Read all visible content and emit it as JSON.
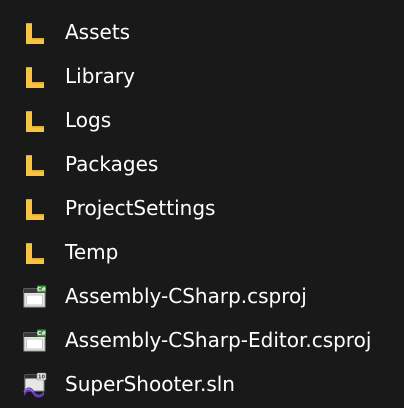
{
  "items": [
    {
      "label": "Assets",
      "type": "folder",
      "icon": "folder-icon"
    },
    {
      "label": "Library",
      "type": "folder",
      "icon": "folder-icon"
    },
    {
      "label": "Logs",
      "type": "folder",
      "icon": "folder-icon"
    },
    {
      "label": "Packages",
      "type": "folder",
      "icon": "folder-icon"
    },
    {
      "label": "ProjectSettings",
      "type": "folder",
      "icon": "folder-icon"
    },
    {
      "label": "Temp",
      "type": "folder",
      "icon": "folder-icon"
    },
    {
      "label": "Assembly-CSharp.csproj",
      "type": "csproj",
      "icon": "csproj-file-icon"
    },
    {
      "label": "Assembly-CSharp-Editor.csproj",
      "type": "csproj",
      "icon": "csproj-file-icon"
    },
    {
      "label": "SuperShooter.sln",
      "type": "sln",
      "icon": "visual-studio-solution-icon"
    }
  ],
  "colors": {
    "background": "#191919",
    "text": "#ffffff",
    "folder": "#f5c542",
    "folder_dark": "#d9a520"
  }
}
